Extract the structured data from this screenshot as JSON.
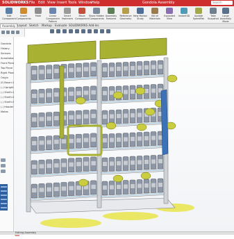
{
  "app": {
    "logo": "SOLIDWORKS",
    "window_title": "Gondola Assembly"
  },
  "menu": [
    "File",
    "Edit",
    "View",
    "Insert",
    "Tools",
    "Window",
    "Help"
  ],
  "search": {
    "placeholder": "Search"
  },
  "ribbon": {
    "buttons": [
      {
        "label": "Edit Component",
        "icon": "edit-component-icon"
      },
      {
        "label": "Insert Components",
        "icon": "insert-components-icon"
      },
      {
        "label": "Mate",
        "icon": "mate-icon"
      },
      {
        "label": "Linear Component Pattern",
        "icon": "pattern-icon"
      },
      {
        "label": "Smart Fasteners",
        "icon": "fastener-icon"
      },
      {
        "label": "Move Component",
        "icon": "move-component-icon"
      },
      {
        "label": "Show Hidden Components",
        "icon": "show-hidden-icon"
      },
      {
        "label": "Assembly Features",
        "icon": "assembly-features-icon"
      },
      {
        "label": "Reference Geometry",
        "icon": "reference-geometry-icon"
      },
      {
        "label": "New Motion Study",
        "icon": "motion-study-icon"
      },
      {
        "label": "Bill of Materials",
        "icon": "bom-icon"
      },
      {
        "label": "Exploded View",
        "icon": "exploded-view-icon"
      },
      {
        "label": "Instant3D",
        "icon": "instant3d-icon"
      },
      {
        "label": "Update SpeedPak",
        "icon": "speedpak-icon"
      },
      {
        "label": "Take Snapshot",
        "icon": "snapshot-icon"
      },
      {
        "label": "Large Assembly Mode",
        "icon": "large-assembly-icon"
      }
    ]
  },
  "tabs": [
    "Assembly",
    "Layout",
    "Sketch",
    "Markup",
    "Evaluate",
    "SOLIDWORKS Add-Ins"
  ],
  "tree": {
    "lines": [
      "Gondola",
      "History",
      "Sensors",
      "Annotations",
      "Front Plane",
      "Top Plane",
      "Right Plane",
      "Origin",
      "(f) Base<1>",
      "(-) Upright<1>",
      "(-) Shelf<1>",
      "(-) Shelf<2>",
      "(-) Shelf<3>",
      "(-) Header<1>",
      "Mates"
    ]
  },
  "status": {
    "text": "Editing Assembly"
  },
  "colors": {
    "title_bar": "#cf2e2e",
    "accent_blue": "#2f5f9e",
    "header_panel": "#a8b132",
    "blister_pack": "#c9cd3f",
    "floor_shadow": "#e8e44a",
    "product": "#8e97a6",
    "shelf": "#ececec",
    "upright": "#cfd3d6",
    "side_bar": "#3c73b8"
  },
  "model": {
    "name": "retail gondola shelving unit",
    "bays": 2,
    "shelves_per_bay": 6,
    "columns_per_shelf": 9,
    "header_panels": 2
  }
}
